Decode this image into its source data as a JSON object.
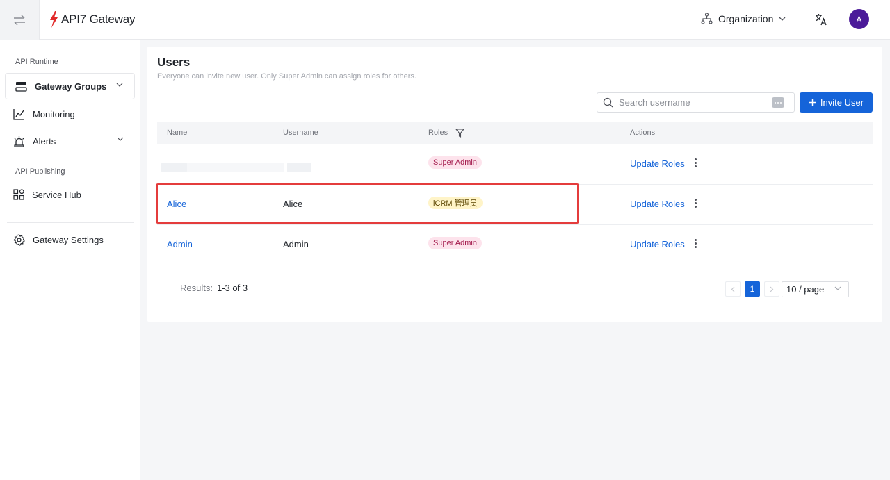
{
  "header": {
    "logo_text": "API7 Gateway",
    "org_label": "Organization",
    "avatar_letter": "A"
  },
  "sidebar": {
    "section_runtime": "API Runtime",
    "section_publishing": "API Publishing",
    "items": [
      {
        "label": "Gateway Groups"
      },
      {
        "label": "Monitoring"
      },
      {
        "label": "Alerts"
      },
      {
        "label": "Service Hub"
      },
      {
        "label": "Gateway Settings"
      }
    ]
  },
  "main": {
    "title": "Users",
    "subtitle": "Everyone can invite new user. Only Super Admin can assign roles for others.",
    "search_placeholder": "Search username",
    "invite_label": "Invite User",
    "columns": [
      "Name",
      "Username",
      "Roles",
      "Actions"
    ],
    "rows": [
      {
        "name": "",
        "username": "",
        "role": "Super Admin",
        "action": "Update Roles"
      },
      {
        "name": "Alice",
        "username": "Alice",
        "role": "iCRM 管理员",
        "action": "Update Roles"
      },
      {
        "name": "Admin",
        "username": "Admin",
        "role": "Super Admin",
        "action": "Update Roles"
      }
    ],
    "results_label": "Results:",
    "results_value": "1-3 of 3",
    "current_page": "1",
    "page_size": "10 / page"
  },
  "colors": {
    "primary": "#1564d9",
    "highlight": "#e43c3c",
    "avatar": "#4b1a99"
  }
}
